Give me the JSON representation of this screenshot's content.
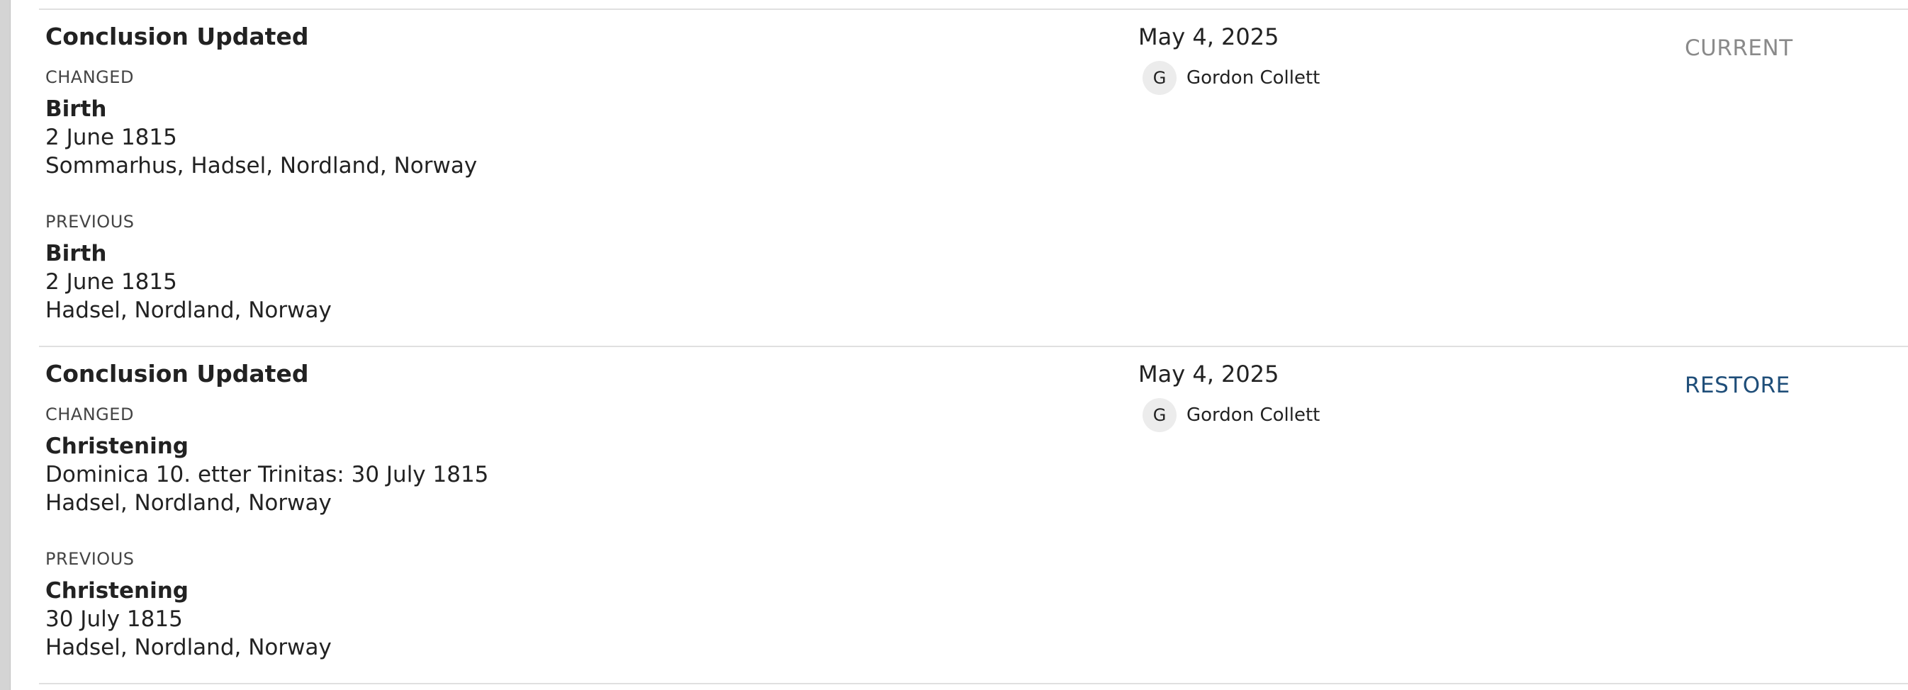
{
  "entries": [
    {
      "title": "Conclusion Updated",
      "changed": {
        "label": "CHANGED",
        "event": "Birth",
        "line1": "2 June 1815",
        "line2": "Sommarhus, Hadsel, Nordland, Norway"
      },
      "previous": {
        "label": "PREVIOUS",
        "event": "Birth",
        "line1": "2 June 1815",
        "line2": "Hadsel, Nordland, Norway"
      },
      "date": "May 4, 2025",
      "contributor": {
        "initial": "G",
        "name": "Gordon Collett"
      },
      "action": "CURRENT"
    },
    {
      "title": "Conclusion Updated",
      "changed": {
        "label": "CHANGED",
        "event": "Christening",
        "line1": "Dominica 10. etter Trinitas: 30 July 1815",
        "line2": "Hadsel, Nordland, Norway"
      },
      "previous": {
        "label": "PREVIOUS",
        "event": "Christening",
        "line1": "30 July 1815",
        "line2": "Hadsel, Nordland, Norway"
      },
      "date": "May 4, 2025",
      "contributor": {
        "initial": "G",
        "name": "Gordon Collett"
      },
      "action": "RESTORE"
    }
  ],
  "colors": {
    "restore_link": "#1f4e79",
    "current_status": "#8a8a8a",
    "divider": "#e0e0e0",
    "left_rail": "#d4d4d4"
  }
}
